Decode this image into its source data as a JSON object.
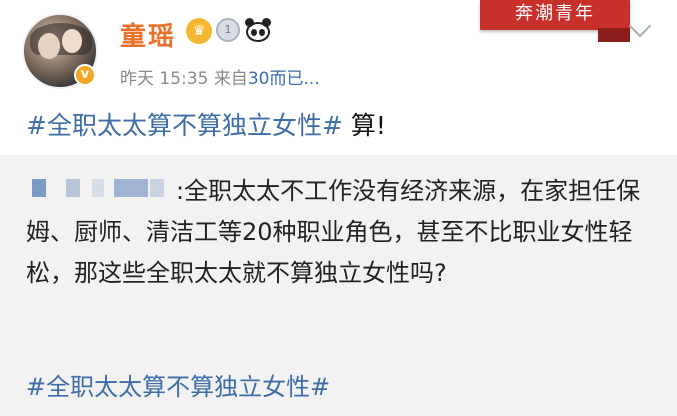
{
  "author": {
    "name": "童瑶",
    "verified_icon": "v-verified-icon"
  },
  "badges": [
    {
      "name": "crown-icon",
      "glyph": "♛"
    },
    {
      "name": "medal-icon",
      "glyph": "1"
    },
    {
      "name": "panda-icon",
      "glyph": "🐼"
    }
  ],
  "meta": {
    "time": "昨天 15:35",
    "source_prefix": "来自",
    "source": "30而已..."
  },
  "ribbon": {
    "text": "奔潮青年"
  },
  "post": {
    "hashtag": "#全职太太算不算独立女性#",
    "text": " 算!"
  },
  "quote": {
    "text": ":全职太太不工作没有经济来源，在家担任保姆、厨师、清洁工等20种职业角色，甚至不比职业女性轻松，那这些全职太太就不算独立女性吗?",
    "hashtag": "#全职太太算不算独立女性#"
  },
  "colors": {
    "username": "#e8722c",
    "link": "#3e6da8",
    "quote_bg": "#f2f2f2",
    "ribbon": "#c9302c"
  }
}
